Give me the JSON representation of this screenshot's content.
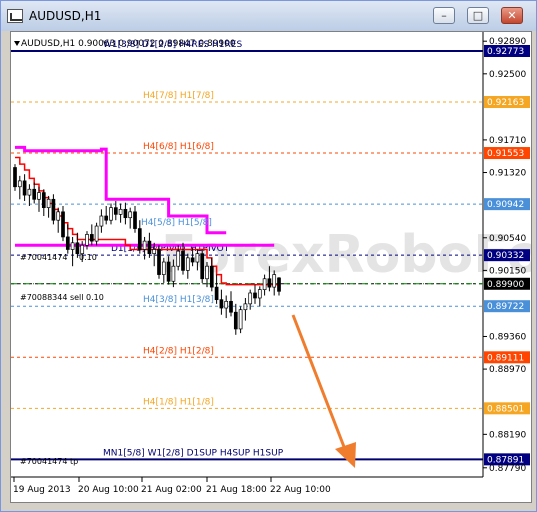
{
  "window": {
    "title": "AUDUSD,H1"
  },
  "chart_info": {
    "symbol_line": "AUDUSD,H1  0.90063 0.90072 0.89847 0.89900"
  },
  "chart_data": {
    "type": "candlestick",
    "y_range": [
      0.8768,
      0.93
    ],
    "price_axis_ticks": [
      "0.92890",
      "0.92500",
      "0.91710",
      "0.91320",
      "0.90540",
      "0.90150",
      "0.89360",
      "0.88970",
      "0.88190",
      "0.87790"
    ],
    "time_axis_labels": [
      "19 Aug 2013",
      "20 Aug 10:00",
      "21 Aug 02:00",
      "21 Aug 18:00",
      "22 Aug 10:00"
    ],
    "levels": [
      {
        "name": "W1[3/8] D1[2/8] H4RES H1RES",
        "price": 0.92773,
        "tag": "0.92773",
        "color": "#00006e",
        "style": "solid"
      },
      {
        "name": "H4[7/8] H1[7/8]",
        "price": 0.92163,
        "tag": "0.92163",
        "color": "#f5a623",
        "style": "dash"
      },
      {
        "name": "H4[6/8] H1[6/8]",
        "price": 0.91553,
        "tag": "0.91553",
        "color": "#ff4500",
        "style": "dash"
      },
      {
        "name": "",
        "price": 0.90942,
        "tag": "0.90942",
        "color": "#4a90d9",
        "style": "dash"
      },
      {
        "name": "D1[1/8] H4PIVOT H1PIVOT",
        "price": 0.90332,
        "tag": "0.90332",
        "color": "#000080",
        "style": "dash"
      },
      {
        "name": "",
        "price": 0.8999,
        "tag": "0.89900",
        "color": "#000000",
        "style": "dash"
      },
      {
        "name": "H4[3/8] H1[3/8]",
        "price": 0.89722,
        "tag": "0.89722",
        "color": "#4a90d9",
        "style": "dash"
      },
      {
        "name": "H4[2/8] H1[2/8]",
        "price": 0.89111,
        "tag": "0.89111",
        "color": "#ff4500",
        "style": "dash"
      },
      {
        "name": "H4[1/8] H1[1/8]",
        "price": 0.88501,
        "tag": "0.88501",
        "color": "#f5a623",
        "style": "dash"
      },
      {
        "name": "MN1[5/8] W1[2/8] D1SUP H4SUP H1SUP",
        "price": 0.87891,
        "tag": "0.87891",
        "color": "#00006e",
        "style": "solid"
      }
    ],
    "extra_labels": {
      "h4_5_8": "H4[5/8] H1[5/8]",
      "order_sell": "#70088344 sell 0.10",
      "order_tp": "#70041474 tp",
      "order_left": "#70041474",
      "order_left_value": "0.10"
    },
    "sell_level": 0.8999,
    "candles": [
      [
        0.9138,
        0.9142,
        0.911,
        0.9115
      ],
      [
        0.9115,
        0.9128,
        0.91,
        0.9122
      ],
      [
        0.9122,
        0.913,
        0.9098,
        0.9105
      ],
      [
        0.9105,
        0.9118,
        0.9092,
        0.9112
      ],
      [
        0.9112,
        0.912,
        0.9095,
        0.91
      ],
      [
        0.91,
        0.9115,
        0.9085,
        0.9108
      ],
      [
        0.9108,
        0.9112,
        0.908,
        0.909
      ],
      [
        0.909,
        0.9104,
        0.9078,
        0.91
      ],
      [
        0.91,
        0.9106,
        0.907,
        0.9075
      ],
      [
        0.9075,
        0.909,
        0.906,
        0.9085
      ],
      [
        0.9085,
        0.9092,
        0.905,
        0.9055
      ],
      [
        0.9055,
        0.907,
        0.9035,
        0.904
      ],
      [
        0.904,
        0.9055,
        0.902,
        0.9048
      ],
      [
        0.9048,
        0.906,
        0.903,
        0.9035
      ],
      [
        0.9035,
        0.905,
        0.9025,
        0.9045
      ],
      [
        0.9045,
        0.9062,
        0.904,
        0.9058
      ],
      [
        0.9058,
        0.907,
        0.9045,
        0.905
      ],
      [
        0.905,
        0.9072,
        0.9045,
        0.9068
      ],
      [
        0.9068,
        0.9088,
        0.906,
        0.908
      ],
      [
        0.908,
        0.9092,
        0.907,
        0.9075
      ],
      [
        0.9075,
        0.9095,
        0.907,
        0.909
      ],
      [
        0.909,
        0.9098,
        0.9075,
        0.9082
      ],
      [
        0.9082,
        0.9095,
        0.9072,
        0.9088
      ],
      [
        0.9088,
        0.9096,
        0.907,
        0.9078
      ],
      [
        0.9078,
        0.909,
        0.9065,
        0.9085
      ],
      [
        0.9085,
        0.9092,
        0.906,
        0.9065
      ],
      [
        0.9065,
        0.9075,
        0.9035,
        0.904
      ],
      [
        0.904,
        0.9055,
        0.9028,
        0.905
      ],
      [
        0.905,
        0.906,
        0.903,
        0.9035
      ],
      [
        0.9035,
        0.9048,
        0.902,
        0.904
      ],
      [
        0.904,
        0.9045,
        0.9005,
        0.901
      ],
      [
        0.901,
        0.903,
        0.9,
        0.9025
      ],
      [
        0.9025,
        0.9032,
        0.8998,
        0.9002
      ],
      [
        0.9002,
        0.9028,
        0.8995,
        0.902
      ],
      [
        0.902,
        0.9045,
        0.9015,
        0.9038
      ],
      [
        0.9038,
        0.9048,
        0.901,
        0.9015
      ],
      [
        0.9015,
        0.9035,
        0.9005,
        0.903
      ],
      [
        0.903,
        0.9042,
        0.902,
        0.9025
      ],
      [
        0.9025,
        0.904,
        0.9015,
        0.9035
      ],
      [
        0.9035,
        0.904,
        0.9,
        0.9005
      ],
      [
        0.9005,
        0.9025,
        0.8995,
        0.902
      ],
      [
        0.902,
        0.903,
        0.899,
        0.8995
      ],
      [
        0.8995,
        0.901,
        0.8975,
        0.898
      ],
      [
        0.898,
        0.8992,
        0.8962,
        0.897
      ],
      [
        0.897,
        0.8985,
        0.8958,
        0.8978
      ],
      [
        0.8978,
        0.899,
        0.896,
        0.8965
      ],
      [
        0.8965,
        0.8975,
        0.8938,
        0.8945
      ],
      [
        0.8945,
        0.8972,
        0.894,
        0.8968
      ],
      [
        0.8968,
        0.8982,
        0.8955,
        0.8975
      ],
      [
        0.8975,
        0.8992,
        0.8968,
        0.8988
      ],
      [
        0.8988,
        0.8998,
        0.8975,
        0.8982
      ],
      [
        0.8982,
        0.8996,
        0.8972,
        0.8992
      ],
      [
        0.8992,
        0.901,
        0.8985,
        0.9005
      ],
      [
        0.9005,
        0.902,
        0.899,
        0.8995
      ],
      [
        0.8995,
        0.9015,
        0.8985,
        0.901
      ],
      [
        0.9006,
        0.9007,
        0.8985,
        0.899
      ]
    ],
    "red_line": [
      0.915,
      0.9142,
      0.9135,
      0.9125,
      0.9118,
      0.911,
      0.9102,
      0.9095,
      0.9088,
      0.908,
      0.9072,
      0.9065,
      0.9058,
      0.9052,
      0.9052,
      0.9052,
      0.9052,
      0.9052,
      0.9052,
      0.9052,
      0.9052,
      0.9052,
      0.9052,
      0.9045,
      0.904,
      0.904,
      0.904,
      0.904,
      0.904,
      0.904,
      0.904,
      0.904,
      0.904,
      0.904,
      0.904,
      0.904,
      0.904,
      0.904,
      0.904,
      0.904,
      0.903,
      0.902,
      0.901,
      0.9,
      0.8998,
      0.8998,
      0.8998,
      0.8998,
      0.8998,
      0.8998,
      0.8998,
      0.8998,
      0.8998,
      0.8998,
      0.8998,
      0.8998
    ],
    "magenta_line": [
      0.9162,
      0.9162,
      0.9158,
      0.9158,
      0.9158,
      0.9158,
      0.9158,
      0.9158,
      0.9158,
      0.9158,
      0.9158,
      0.9158,
      0.9158,
      0.9158,
      0.9158,
      0.9158,
      0.9158,
      0.9158,
      0.916,
      0.91,
      0.91,
      0.91,
      0.91,
      0.91,
      0.91,
      0.91,
      0.91,
      0.91,
      0.91,
      0.91,
      0.91,
      0.91,
      0.908,
      0.908,
      0.908,
      0.908,
      0.908,
      0.908,
      0.908,
      0.908,
      0.906,
      0.906,
      0.906,
      0.906,
      0.906
    ],
    "magenta_lower": [
      0.9045,
      0.9045,
      0.9045,
      0.9045,
      0.9045,
      0.9045,
      0.9045,
      0.9045,
      0.9045,
      0.9045,
      0.9045,
      0.9045,
      0.9045,
      0.9045,
      0.9045,
      0.9045,
      0.9045,
      0.9045,
      0.9045,
      0.9045,
      0.9045,
      0.9045,
      0.9045,
      0.9045,
      0.9045,
      0.9045,
      0.9045,
      0.9045,
      0.9045,
      0.9045,
      0.9045,
      0.9045,
      0.9045,
      0.9045,
      0.9045,
      0.9045,
      0.9045,
      0.9045,
      0.9045,
      0.9045,
      0.9045,
      0.9045,
      0.9045,
      0.9045,
      0.9045,
      0.9045,
      0.9045,
      0.9045,
      0.9045,
      0.9045,
      0.9045,
      0.9045,
      0.9045,
      0.9045,
      0.9045
    ]
  }
}
